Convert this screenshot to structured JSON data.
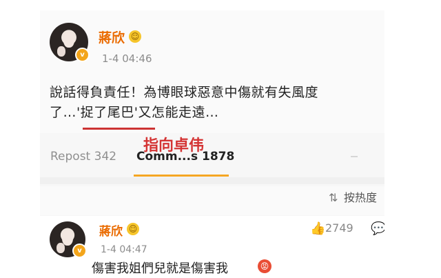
{
  "post": {
    "author": "蔣欣",
    "time": "1-4 04:46",
    "line1": "說話得負責任！為博眼球惡意中傷就有失風度",
    "line2": "了…'捉了尾巴'又怎能走遠…"
  },
  "annotation": "指向卓伟",
  "tabs": {
    "repost": "Repost 342",
    "comments": "Comm...s 1878"
  },
  "sort": {
    "label": "按热度",
    "icon": "sort-icon"
  },
  "comment": {
    "author": "蔣欣",
    "time": "1-4 04:47",
    "likes": "2749",
    "text": "傷害我姐們兒就是傷害我"
  },
  "icons": {
    "verified": "verified-badge-icon",
    "like": "thumbs-up-icon",
    "comment": "comment-icon",
    "angry": "angry-emoji-icon"
  },
  "colors": {
    "name": "#ea6b00",
    "annotation": "#d43434",
    "tab_active": "#f5a623"
  }
}
